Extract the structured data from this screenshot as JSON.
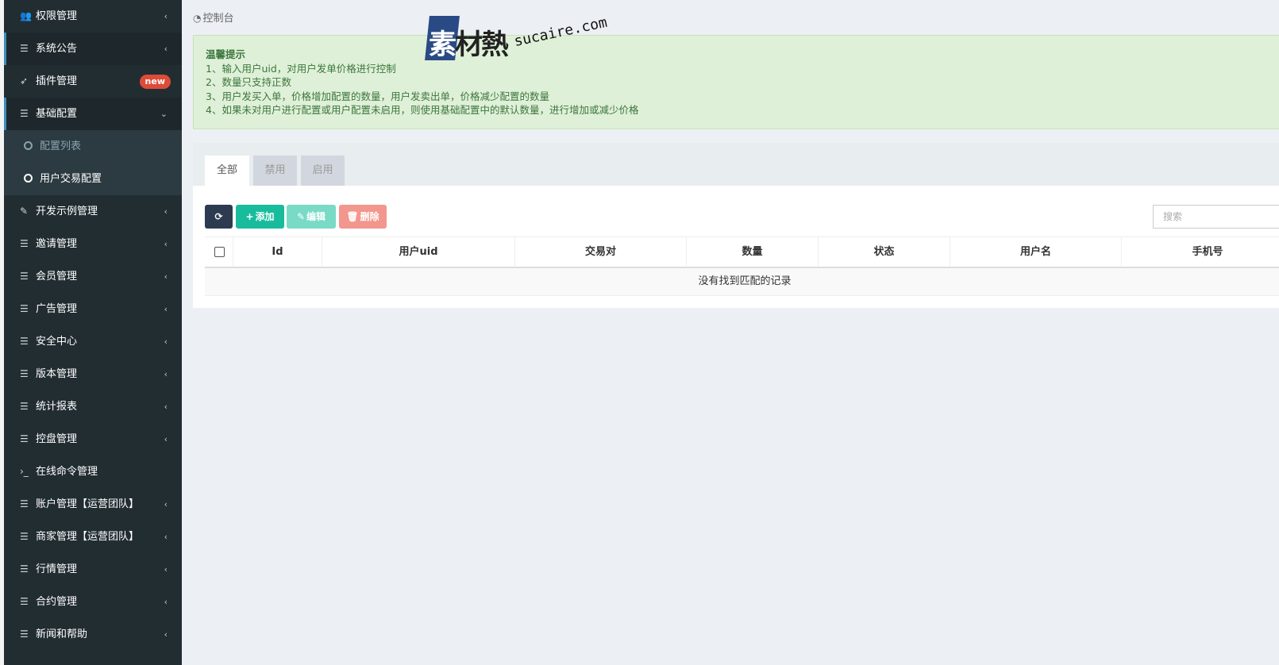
{
  "sidebar": {
    "items": [
      {
        "icon": "users-icon",
        "glyph": "👥",
        "label": "权限管理",
        "arrow": "‹"
      },
      {
        "icon": "list-icon",
        "glyph": "☰",
        "label": "系统公告",
        "arrow": "‹"
      },
      {
        "icon": "rocket-icon",
        "glyph": "➶",
        "label": "插件管理",
        "badge": "new"
      },
      {
        "icon": "list-icon",
        "glyph": "☰",
        "label": "基础配置",
        "arrow": "⌄"
      },
      {
        "label": "配置列表"
      },
      {
        "label": "用户交易配置"
      },
      {
        "icon": "magic-icon",
        "glyph": "✎",
        "label": "开发示例管理",
        "arrow": "‹"
      },
      {
        "icon": "list-icon",
        "glyph": "☰",
        "label": "邀请管理",
        "arrow": "‹"
      },
      {
        "icon": "list-icon",
        "glyph": "☰",
        "label": "会员管理",
        "arrow": "‹"
      },
      {
        "icon": "list-icon",
        "glyph": "☰",
        "label": "广告管理",
        "arrow": "‹"
      },
      {
        "icon": "list-icon",
        "glyph": "☰",
        "label": "安全中心",
        "arrow": "‹"
      },
      {
        "icon": "list-icon",
        "glyph": "☰",
        "label": "版本管理",
        "arrow": "‹"
      },
      {
        "icon": "list-icon",
        "glyph": "☰",
        "label": "统计报表",
        "arrow": "‹"
      },
      {
        "icon": "list-icon",
        "glyph": "☰",
        "label": "控盘管理",
        "arrow": "‹"
      },
      {
        "icon": "terminal-icon",
        "glyph": "›_",
        "label": "在线命令管理"
      },
      {
        "icon": "list-icon",
        "glyph": "☰",
        "label": "账户管理【运营团队】",
        "arrow": "‹"
      },
      {
        "icon": "list-icon",
        "glyph": "☰",
        "label": "商家管理【运营团队】",
        "arrow": "‹"
      },
      {
        "icon": "list-icon",
        "glyph": "☰",
        "label": "行情管理",
        "arrow": "‹"
      },
      {
        "icon": "list-icon",
        "glyph": "☰",
        "label": "合约管理",
        "arrow": "‹"
      },
      {
        "icon": "list-icon",
        "glyph": "☰",
        "label": "新闻和帮助",
        "arrow": "‹"
      }
    ]
  },
  "breadcrumb": {
    "icon_glyph": "◔",
    "label": "控制台"
  },
  "callout": {
    "title": "温馨提示",
    "lines": [
      "1、输入用户uid，对用户发单价格进行控制",
      "2、数量只支持正数",
      "3、用户发买入单，价格增加配置的数量，用户发卖出单，价格减少配置的数量",
      "4、如果未对用户进行配置或用户配置未启用，则使用基础配置中的默认数量，进行增加或减少价格"
    ]
  },
  "watermark": {
    "brand": "素材熱",
    "brand_first": "素",
    "brand_rest": "材熱",
    "url": "sucaire.com"
  },
  "tabs": [
    "全部",
    "禁用",
    "启用"
  ],
  "toolbar": {
    "refresh_glyph": "⟳",
    "add_glyph": "+",
    "add_label": "添加",
    "edit_glyph": "✎",
    "edit_label": "编辑",
    "delete_glyph": "🗑",
    "delete_label": "删除"
  },
  "search": {
    "placeholder": "搜索"
  },
  "table": {
    "columns": [
      "Id",
      "用户uid",
      "交易对",
      "数量",
      "状态",
      "用户名",
      "手机号"
    ],
    "empty_text": "没有找到匹配的记录"
  },
  "colors": {
    "sidebar_bg": "#222d32",
    "callout_bg": "#dff0d8",
    "callout_text": "#3c763d",
    "btn_add": "#18bc9c",
    "btn_delete": "#f3968d",
    "badge": "#dd4b39"
  }
}
